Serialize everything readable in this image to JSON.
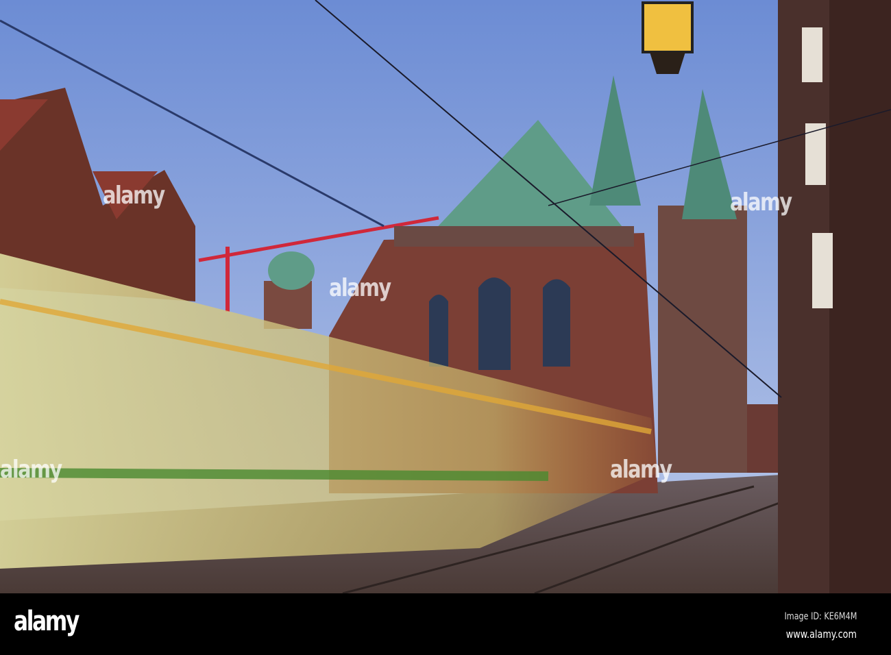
{
  "photo": {
    "subject": "Bremen town hall and cathedral at dusk with blurred tram",
    "colors": {
      "sky_top": "#6f8fd6",
      "sky_bottom": "#b9c8ea",
      "brick": "#7a3f33",
      "copper_roof": "#5f9c88",
      "tram": "#c9c77a",
      "street": "#5a4a48"
    }
  },
  "watermark": {
    "text": "alamy"
  },
  "footer": {
    "logo": "alamy",
    "image_id": "Image ID: KE6M4M",
    "url": "www.alamy.com"
  }
}
